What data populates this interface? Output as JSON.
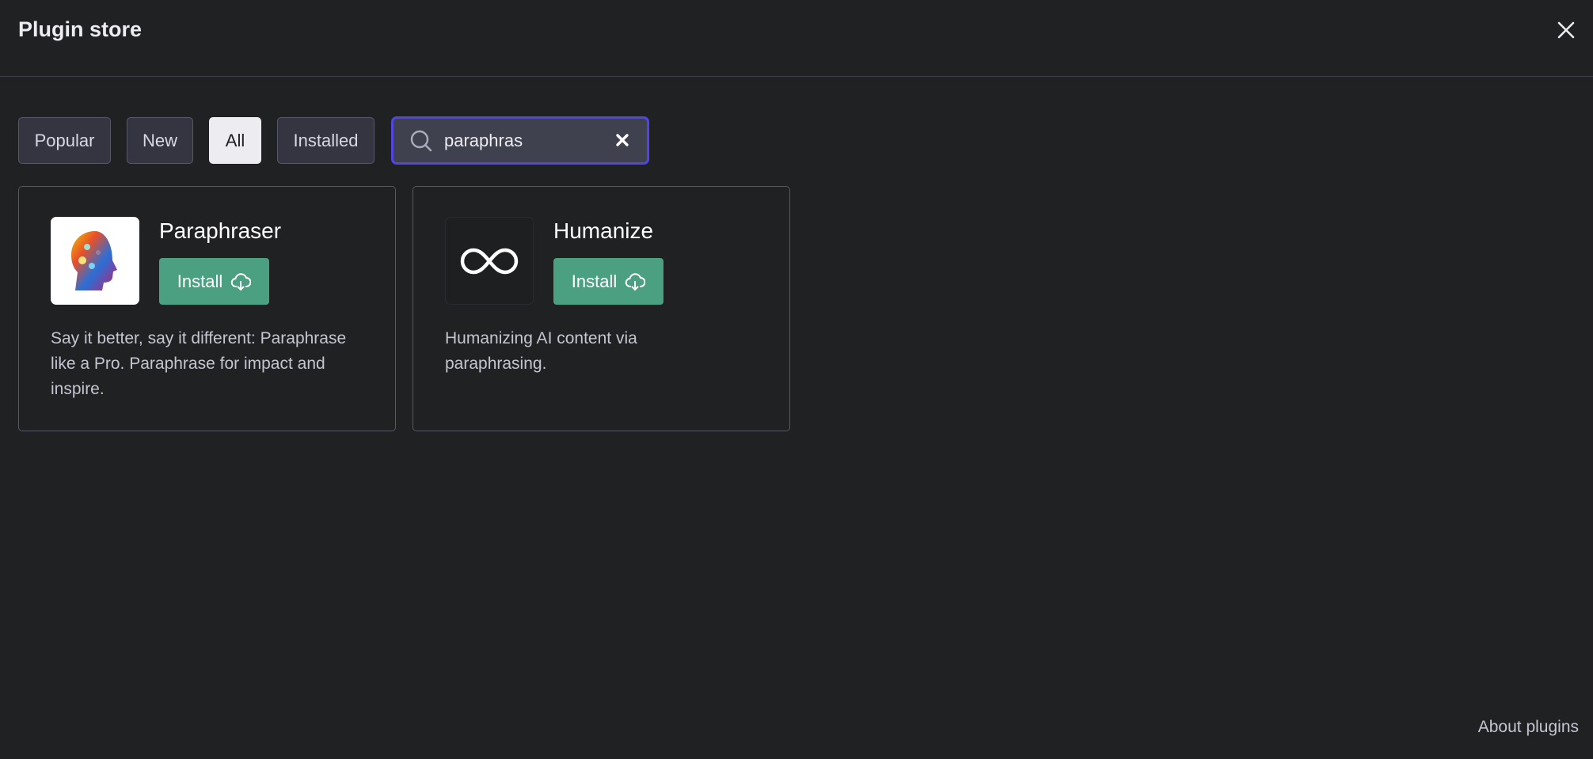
{
  "header": {
    "title": "Plugin store"
  },
  "filters": [
    {
      "label": "Popular"
    },
    {
      "label": "New"
    },
    {
      "label": "All",
      "active": true
    },
    {
      "label": "Installed"
    }
  ],
  "search": {
    "value": "paraphras",
    "icon": "search-icon",
    "clear_icon": "close-icon"
  },
  "plugins": [
    {
      "name": "Paraphraser",
      "install_label": "Install",
      "description": "Say it better, say it different: Paraphrase like a Pro. Paraphrase for impact and inspire.",
      "icon": "colorful-head-logo"
    },
    {
      "name": "Humanize",
      "install_label": "Install",
      "description": "Humanizing AI content via paraphrasing.",
      "icon": "infinity-logo"
    }
  ],
  "footer": {
    "about_label": "About plugins"
  },
  "colors": {
    "background": "#202123",
    "accent_border": "#4f46e5",
    "install_green": "#4aa081"
  }
}
